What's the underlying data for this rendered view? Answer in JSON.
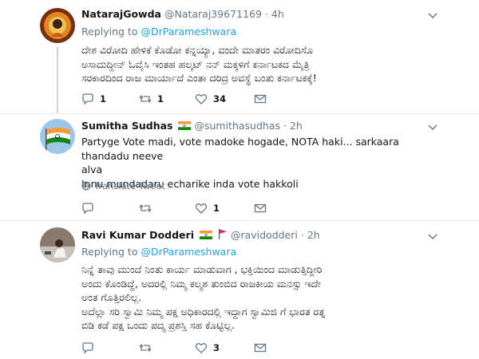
{
  "tweets": [
    {
      "name": "NatarajGowda",
      "handle": "@Nataraj39671169",
      "separator": "·",
      "time": "4h",
      "replying_prefix": "Replying to ",
      "replying_to": "@DrParameshwara",
      "lines": [
        "ದೇಶ ವಿರೋದಿ ಹೇಳಿಕೆ ಕೊಡೋ ಕನ್ನಯ್ಯಾ, ವಂದೇ ಮಾತರಂ ವಿರೋದಿಸೊ",
        "ಅಸಾದುದ್ದೀನ್ ಓವೈಸಿ ಇಂತಹ ಹಲ್ಕಟ್ ನನ್ ಮಕ್ಕಳಿಗೆ ಕರ್ನಾಟಕದ ಮೈತ್ರಿ",
        "ಸರಕಾರದಿಂದ ರಾಜ ಮಾರ್ಯಾದೆ ಎಂತಾ ದರಿದ್ರ ಅವಸ್ಥೆ ಬಂತು ಕರ್ನಾಟಕಕ್ಕೆ!"
      ],
      "actions": {
        "reply": "1",
        "retweet": "1",
        "like": "34"
      }
    },
    {
      "name": "Sumitha Sudhas",
      "handle": "@sumithasudhas",
      "separator": "·",
      "time": "2h",
      "lines": [
        "Partyge Vote madi, vote madoke hogade, NOTA haki... sarkaara thandadu neeve",
        "alva",
        "Innu mundadaru echarike inda vote hakkoli"
      ],
      "translate_label": "Translate Tweet",
      "actions": {
        "reply": "",
        "retweet": "",
        "like": "1"
      }
    },
    {
      "name": "Ravi Kumar Dodderi",
      "handle": "@ravidodderi",
      "separator": "·",
      "time": "2h",
      "replying_prefix": "Replying to ",
      "replying_to": "@DrParameshwara",
      "lines": [
        "ನಿನ್ನೆ ತಾವು ಮುಂದೆ ನಿಂತು ಕಾರ್ಯ ಮಾಡುವಾಗ , ಭಕ್ತಿಯಿಂದ ಮಾಡುತ್ತಿದ್ದೀರಿ",
        "ಅಂದು ಕೊಂಡಿದ್ದೆ, ಅದರಲ್ಲಿ ನಿಮ್ಮ ಕಲ್ಮಶ ತುಂಬಿದ ರಾಜಕೀಯ ಮನಸ್ಸು ಇದೇ",
        "ಅಂತ ಗೊತ್ತಿರಲಿಲ್ಲ.",
        "ಅದೆಲ್ಲಾ ಸರಿ ಸ್ವಾಮಿ ನಿಮ್ಮ ಪಕ್ಷ ಅಧಿಕಾರದಲ್ಲಿ ಇದ್ದಾಗ ಸ್ವಾಮಿಜಿ ಗೆ ಭಾರತ ರತ್ನ",
        "ಬಿಡಿ ಕಡೆ ಪಕ್ಷ ಒಂದು ಪದ್ಮ ಪ್ರಶಸ್ತಿ ಸಹ ಕೊಟ್ಟಿಲ್ಲ."
      ],
      "actions": {
        "reply": "",
        "retweet": "",
        "like": "3"
      }
    }
  ],
  "colors": {
    "accent": "#1da1f2",
    "muted": "#657786",
    "text": "#14171a",
    "divider": "#e6ecf0"
  },
  "icons": {
    "reply": "reply-icon",
    "retweet": "retweet-icon",
    "like": "heart-icon",
    "dm": "envelope-icon",
    "caret": "chevron-down-icon",
    "translate": "globe-icon"
  }
}
